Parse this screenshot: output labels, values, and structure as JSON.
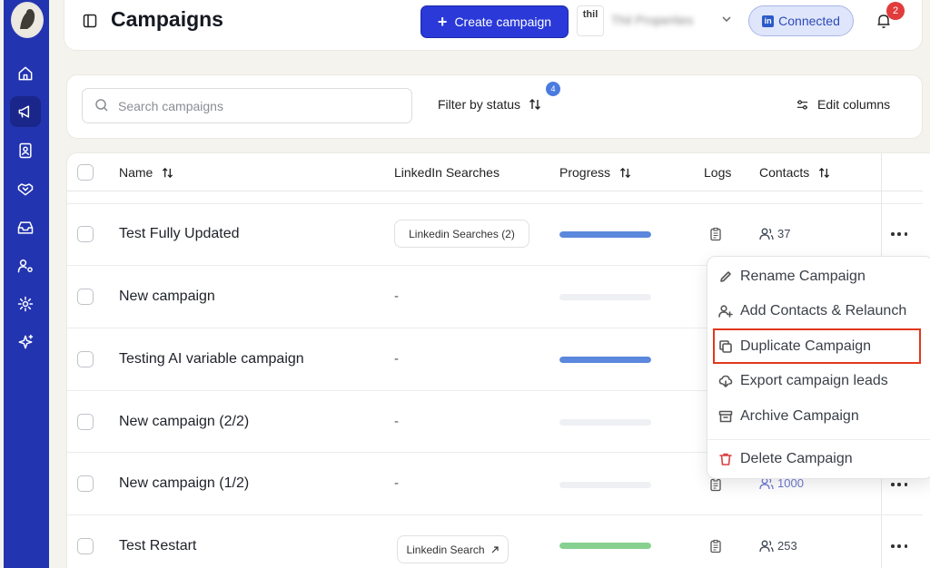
{
  "header": {
    "title": "Campaigns",
    "create_label": "Create campaign",
    "org_logo_text": "thil",
    "org_name": "Thil Properties",
    "connected_label": "Connected",
    "notification_count": "2"
  },
  "toolbar": {
    "search_placeholder": "Search campaigns",
    "filter_label": "Filter by status",
    "filter_count": "4",
    "edit_columns_label": "Edit columns"
  },
  "table": {
    "columns": {
      "name": "Name",
      "linkedin_searches": "LinkedIn Searches",
      "progress": "Progress",
      "logs": "Logs",
      "contacts": "Contacts"
    },
    "rows": [
      {
        "name": "Test Fully Updated",
        "search": "Linkedin Searches (2)",
        "progress_color": "#5b88dc",
        "progress": 1.0,
        "contacts": "37"
      },
      {
        "name": "New campaign",
        "search": "-",
        "progress": 0,
        "contacts": ""
      },
      {
        "name": "Testing AI variable campaign",
        "search": "-",
        "progress_color": "#5b88dc",
        "progress": 1.0,
        "contacts": ""
      },
      {
        "name": "New campaign (2/2)",
        "search": "-",
        "progress": 0,
        "contacts": ""
      },
      {
        "name": "New campaign (1/2)",
        "search": "-",
        "progress": 0,
        "contacts": "1000"
      },
      {
        "name": "Test Restart",
        "search": "Linkedin Search",
        "progress_color": "#86d190",
        "progress": 1.0,
        "contacts": "253"
      }
    ]
  },
  "context_menu": {
    "items": [
      {
        "label": "Rename Campaign",
        "icon": "pencil-icon"
      },
      {
        "label": "Add Contacts & Relaunch",
        "icon": "user-plus-icon"
      },
      {
        "label": "Duplicate Campaign",
        "icon": "copy-icon"
      },
      {
        "label": "Export campaign leads",
        "icon": "cloud-download-icon"
      },
      {
        "label": "Archive Campaign",
        "icon": "archive-icon"
      },
      {
        "label": "Delete Campaign",
        "icon": "trash-icon"
      }
    ],
    "highlight_color": "#e2381d"
  },
  "colors": {
    "sidebar": "#2334b0",
    "primary_button": "#2a39d8",
    "connected_bg": "#dfe6fb",
    "badge_red": "#e13b3b"
  }
}
